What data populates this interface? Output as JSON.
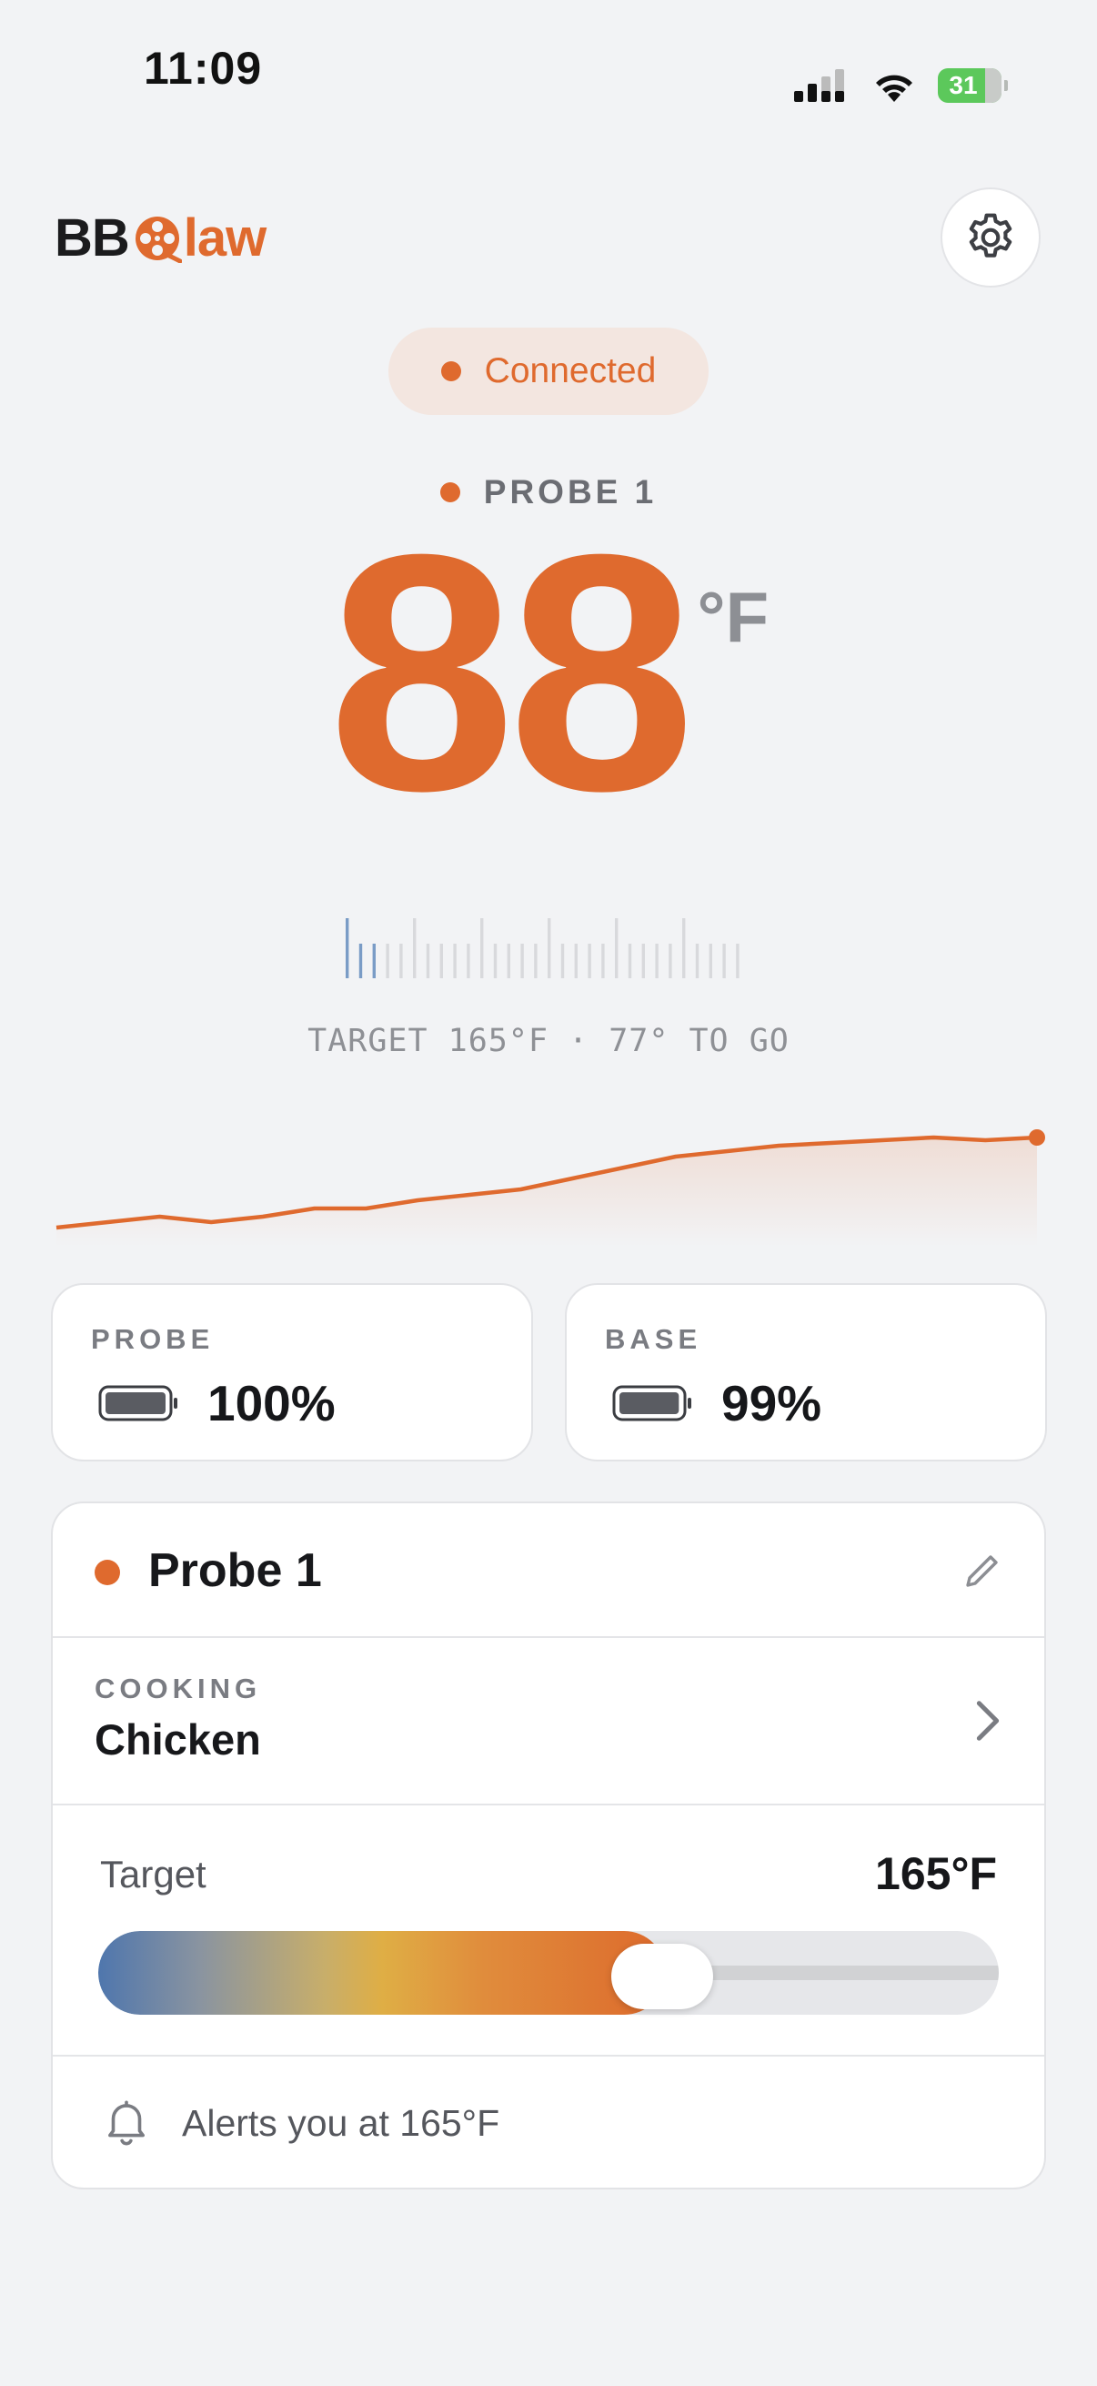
{
  "status_bar": {
    "time": "11:09",
    "battery_level": "31"
  },
  "header": {
    "logo_left": "BB",
    "logo_right": "law"
  },
  "connection": {
    "status": "Connected"
  },
  "probe": {
    "label": "PROBE 1",
    "temperature": "88",
    "unit": "°F",
    "target_text": "TARGET 165°F · 77° TO GO",
    "progress_fraction": 0.533,
    "history_f": [
      55,
      57,
      59,
      57,
      59,
      62,
      62,
      65,
      67,
      69,
      73,
      77,
      81,
      83,
      85,
      86,
      87,
      88,
      87,
      88
    ]
  },
  "batteries": {
    "probe": {
      "label": "PROBE",
      "value": "100%",
      "level": 1.0
    },
    "base": {
      "label": "BASE",
      "value": "99%",
      "level": 0.99
    }
  },
  "probe_card": {
    "name": "Probe 1",
    "cooking_label": "COOKING",
    "cooking_value": "Chicken",
    "target_label": "Target",
    "target_value": "165°F",
    "target_fraction": 0.62,
    "alert_text": "Alerts you at 165°F"
  },
  "colors": {
    "accent": "#df6a2e",
    "background": "#f2f3f5",
    "tick_active": "#7a9cc6",
    "tick_inactive": "#d8d9dc"
  }
}
